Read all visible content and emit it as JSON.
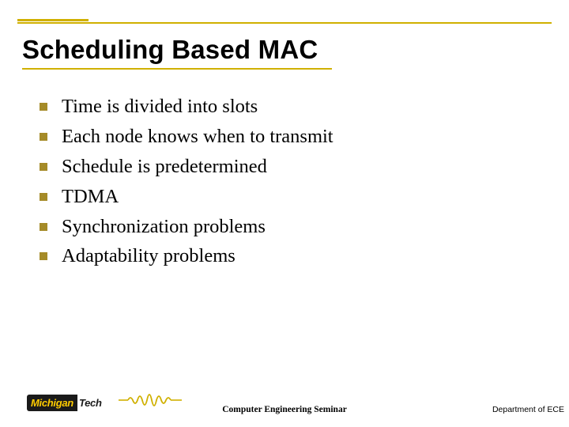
{
  "title": "Scheduling Based MAC",
  "bullets": [
    "Time is divided into slots",
    "Each node knows when to transmit",
    "Schedule is predetermined",
    "TDMA",
    "Synchronization problems",
    "Adaptability problems"
  ],
  "footer": {
    "logo_left": "Michigan",
    "logo_right": "Tech",
    "seminar": "Computer Engineering Seminar",
    "department": "Department of ECE"
  },
  "colors": {
    "accent": "#d0b000",
    "bullet": "#a58b28",
    "logo_bg": "#1a1a1a",
    "logo_fg": "#ffcc00"
  }
}
